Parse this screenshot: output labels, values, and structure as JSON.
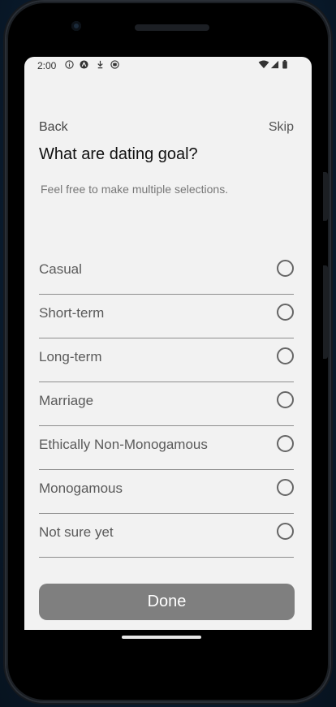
{
  "status_bar": {
    "time": "2:00",
    "left_icons": [
      "info-icon",
      "app-logo-icon",
      "download-arrow-icon",
      "shield-icon"
    ],
    "right_icons": [
      "wifi-icon",
      "signal-icon",
      "battery-icon"
    ]
  },
  "header": {
    "back_label": "Back",
    "skip_label": "Skip"
  },
  "title": "What are dating goal?",
  "subtitle": "Feel free to make multiple selections.",
  "options": [
    {
      "label": "Casual",
      "selected": false
    },
    {
      "label": "Short-term",
      "selected": false
    },
    {
      "label": "Long-term",
      "selected": false
    },
    {
      "label": "Marriage",
      "selected": false
    },
    {
      "label": "Ethically Non-Monogamous",
      "selected": false
    },
    {
      "label": "Monogamous",
      "selected": false
    },
    {
      "label": "Not sure yet",
      "selected": false
    }
  ],
  "done_label": "Done",
  "colors": {
    "screen_bg": "#f2f2f2",
    "button_bg": "#7f7f7f",
    "divider": "#8e8e8e",
    "text_title": "#111111",
    "text_option": "#5a5a5a"
  }
}
